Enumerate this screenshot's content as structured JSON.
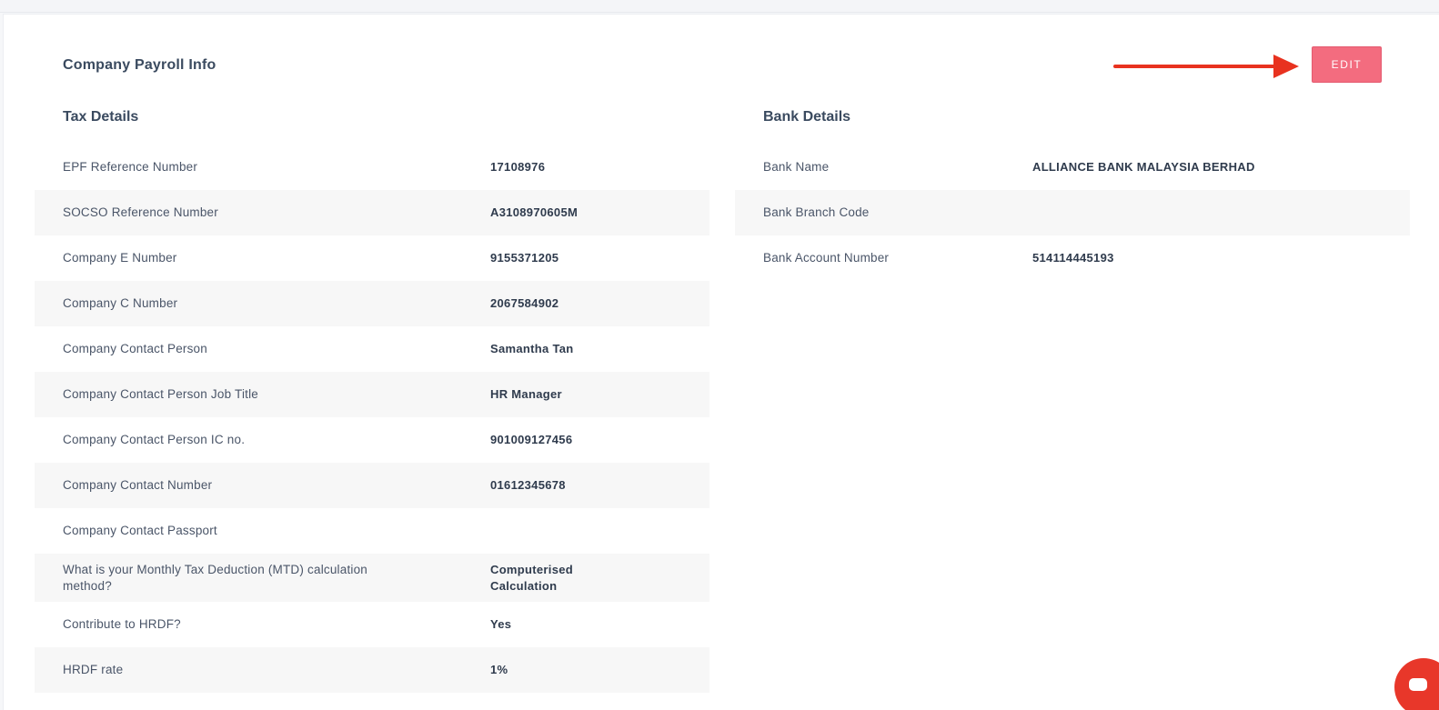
{
  "page": {
    "title": "Company Payroll Info",
    "edit_label": "EDIT"
  },
  "colors": {
    "accent": "#f36c7f",
    "arrow": "#e8321f",
    "chat": "#e8372a"
  },
  "tax": {
    "title": "Tax Details",
    "rows": [
      {
        "label": "EPF Reference Number",
        "value": "17108976"
      },
      {
        "label": "SOCSO Reference Number",
        "value": "A3108970605M"
      },
      {
        "label": "Company E Number",
        "value": "9155371205"
      },
      {
        "label": "Company C Number",
        "value": "2067584902"
      },
      {
        "label": "Company Contact Person",
        "value": "Samantha Tan"
      },
      {
        "label": "Company Contact Person Job Title",
        "value": "HR Manager"
      },
      {
        "label": "Company Contact Person IC no.",
        "value": "901009127456"
      },
      {
        "label": "Company Contact Number",
        "value": "01612345678"
      },
      {
        "label": "Company Contact Passport",
        "value": ""
      },
      {
        "label": "What is your Monthly Tax Deduction (MTD) calculation method?",
        "value": "Computerised Calculation"
      },
      {
        "label": "Contribute to HRDF?",
        "value": "Yes"
      },
      {
        "label": "HRDF rate",
        "value": "1%"
      }
    ]
  },
  "bank": {
    "title": "Bank Details",
    "rows": [
      {
        "label": "Bank Name",
        "value": "ALLIANCE BANK MALAYSIA BERHAD"
      },
      {
        "label": "Bank Branch Code",
        "value": ""
      },
      {
        "label": "Bank Account Number",
        "value": "514114445193"
      }
    ]
  },
  "icons": {
    "arrow": "right-arrow-icon",
    "chat": "chat-bubble-icon"
  }
}
